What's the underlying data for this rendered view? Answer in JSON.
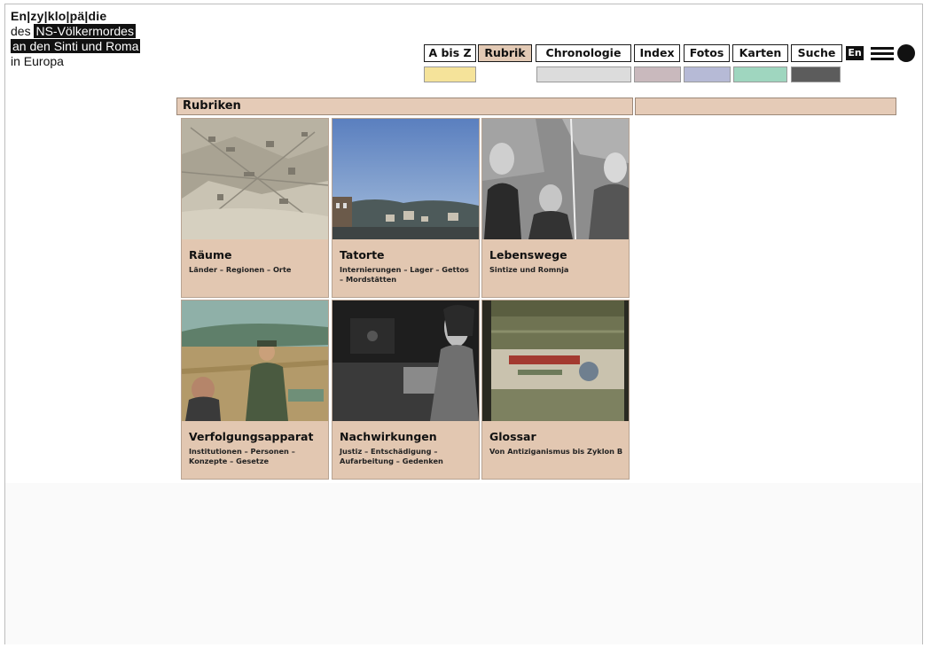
{
  "logo": {
    "line1": "En|zy|klo|pä|die",
    "line2_prefix": "des ",
    "line2_highlight": "NS-Völkermordes",
    "line3_highlight": "an den Sinti und Roma",
    "line4": "in Europa"
  },
  "nav": {
    "items": [
      {
        "label": "A bis Z",
        "active": false
      },
      {
        "label": "Rubrik",
        "active": true
      },
      {
        "label": "Chronologie",
        "active": false
      },
      {
        "label": "Index",
        "active": false
      },
      {
        "label": "Fotos",
        "active": false
      },
      {
        "label": "Karten",
        "active": false
      },
      {
        "label": "Suche",
        "active": false
      }
    ],
    "language": "En",
    "menu_icon": "hamburger-icon",
    "circle_icon": "filled-circle-icon"
  },
  "swatches": {
    "colors": [
      "#f5e39a",
      "#dcdcdc",
      "#c9b9bd",
      "#b6bad6",
      "#9fd6bf",
      "#5c5c5c"
    ]
  },
  "section": {
    "title": "Rubriken"
  },
  "tiles": [
    {
      "title": "Räume",
      "subtitle": "Länder – Regionen – Orte",
      "image": "aerial-map-photo"
    },
    {
      "title": "Tatorte",
      "subtitle": "Internierungen – Lager – Gettos – Mordstätten",
      "image": "town-landscape-photo"
    },
    {
      "title": "Lebenswege",
      "subtitle": "Sintize und Romnja",
      "image": "group-portrait-photo"
    },
    {
      "title": "Verfolgungsapparat",
      "subtitle": "Institutionen – Personen – Konzepte – Gesetze",
      "image": "soldier-field-photo"
    },
    {
      "title": "Nachwirkungen",
      "subtitle": "Justiz – Entschädigung – Aufarbeitung – Gedenken",
      "image": "woman-profile-photo"
    },
    {
      "title": "Glossar",
      "subtitle": "Von Antiziganismus bis Zyklon B",
      "image": "gas-canister-photo"
    }
  ]
}
